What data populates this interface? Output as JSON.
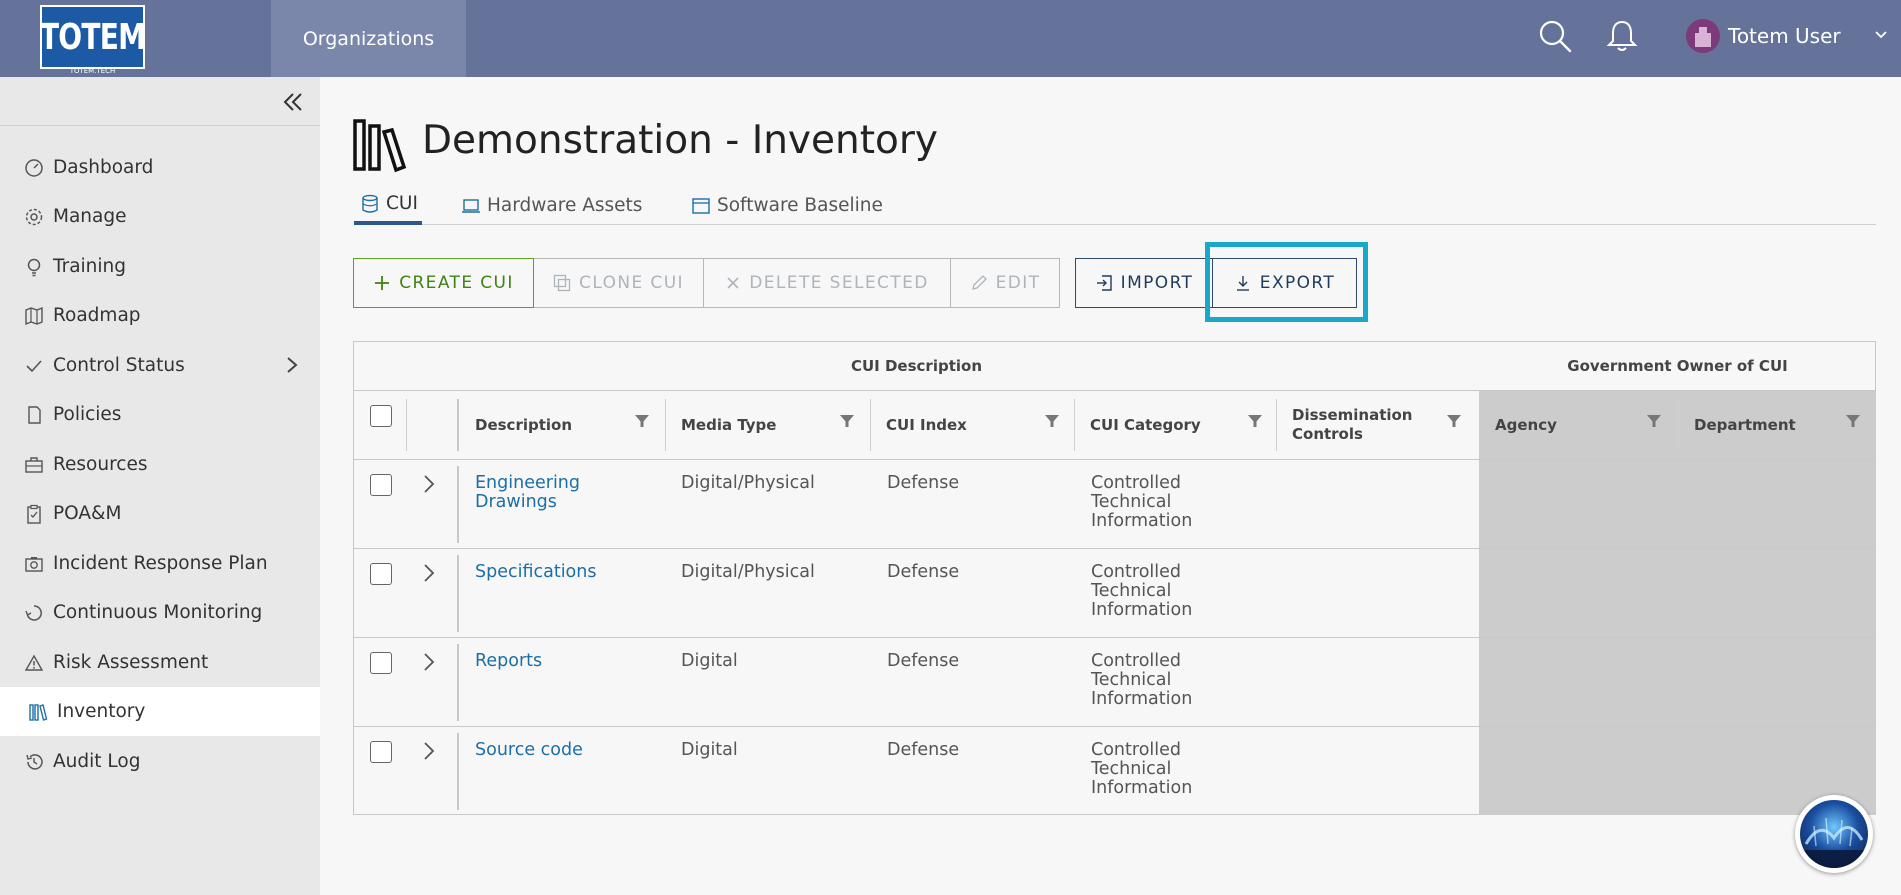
{
  "header": {
    "logo_text": "TOTEM",
    "logo_subtext": "TOTEM.TECH",
    "nav_organizations": "Organizations",
    "user_name": "Totem User"
  },
  "sidebar": {
    "items": [
      {
        "label": "Dashboard",
        "icon": "dashboard-icon"
      },
      {
        "label": "Manage",
        "icon": "gear-icon"
      },
      {
        "label": "Training",
        "icon": "lightbulb-icon"
      },
      {
        "label": "Roadmap",
        "icon": "map-icon"
      },
      {
        "label": "Control Status",
        "icon": "check-icon"
      },
      {
        "label": "Policies",
        "icon": "document-icon"
      },
      {
        "label": "Resources",
        "icon": "briefcase-icon"
      },
      {
        "label": "POA&M",
        "icon": "clipboard-icon"
      },
      {
        "label": "Incident Response Plan",
        "icon": "camera-icon"
      },
      {
        "label": "Continuous Monitoring",
        "icon": "recycle-icon"
      },
      {
        "label": "Risk Assessment",
        "icon": "warning-icon"
      },
      {
        "label": "Inventory",
        "icon": "books-icon",
        "active": true
      },
      {
        "label": "Audit Log",
        "icon": "history-icon"
      }
    ]
  },
  "page": {
    "title": "Demonstration - Inventory",
    "tabs": [
      {
        "label": "CUI",
        "active": true
      },
      {
        "label": "Hardware Assets"
      },
      {
        "label": "Software Baseline"
      }
    ]
  },
  "toolbar": {
    "create": "CREATE CUI",
    "clone": "CLONE CUI",
    "delete": "DELETE SELECTED",
    "edit": "EDIT",
    "import": "IMPORT",
    "export": "EXPORT"
  },
  "table": {
    "group_headers": {
      "cui_description": "CUI Description",
      "government_owner": "Government Owner of CUI"
    },
    "columns": {
      "description": "Description",
      "media_type": "Media Type",
      "cui_index": "CUI Index",
      "cui_category": "CUI Category",
      "dissemination_1": "Dissemination",
      "dissemination_2": "Controls",
      "agency": "Agency",
      "department": "Department"
    },
    "rows": [
      {
        "description_1": "Engineering",
        "description_2": "Drawings",
        "media_type": "Digital/Physical",
        "cui_index": "Defense",
        "cat_1": "Controlled",
        "cat_2": "Technical",
        "cat_3": "Information"
      },
      {
        "description_1": "Specifications",
        "description_2": "",
        "media_type": "Digital/Physical",
        "cui_index": "Defense",
        "cat_1": "Controlled",
        "cat_2": "Technical",
        "cat_3": "Information"
      },
      {
        "description_1": "Reports",
        "description_2": "",
        "media_type": "Digital",
        "cui_index": "Defense",
        "cat_1": "Controlled",
        "cat_2": "Technical",
        "cat_3": "Information"
      },
      {
        "description_1": "Source code",
        "description_2": "",
        "media_type": "Digital",
        "cui_index": "Defense",
        "cat_1": "Controlled",
        "cat_2": "Technical",
        "cat_3": "Information"
      }
    ]
  },
  "colors": {
    "header_bg": "#65739a",
    "accent_highlight": "#19a8c9",
    "link": "#1c6ea4",
    "create_green": "#3f8214"
  }
}
